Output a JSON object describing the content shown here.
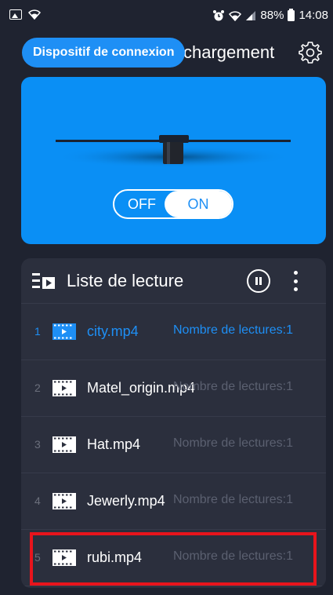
{
  "status_bar": {
    "battery": "88%",
    "time": "14:08"
  },
  "header": {
    "connect_button": "Dispositif de connexion",
    "title": "chargement"
  },
  "device": {
    "toggle_off": "OFF",
    "toggle_on": "ON",
    "power_on": true
  },
  "playlist": {
    "title": "Liste de lecture",
    "items": [
      {
        "num": "1",
        "name": "city.mp4",
        "count": "Nombre de lectures:1",
        "active": true
      },
      {
        "num": "2",
        "name": "Matel_origin.mp4",
        "count": "Nombre de lectures:1",
        "active": false
      },
      {
        "num": "3",
        "name": "Hat.mp4",
        "count": "Nombre de lectures:1",
        "active": false
      },
      {
        "num": "4",
        "name": "Jewerly.mp4",
        "count": "Nombre de lectures:1",
        "active": false
      },
      {
        "num": "5",
        "name": "rubi.mp4",
        "count": "Nombre de lectures:1",
        "active": false
      }
    ]
  },
  "colors": {
    "accent": "#1e8ff5",
    "panel_bg": "#2b2f3d",
    "page_bg": "#1f2330",
    "highlight": "#e8141c"
  }
}
